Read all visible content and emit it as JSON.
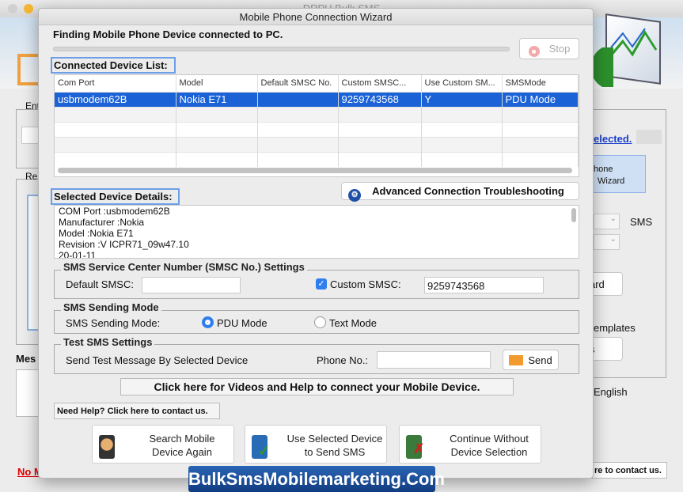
{
  "background_app": {
    "title": "DRPU Bulk SMS",
    "fragments": {
      "enter": "Ent",
      "recipients": "Re",
      "message": "Mes",
      "no": "No M",
      "selected_link": "elected.",
      "wizard_btn_line1": "hone",
      "wizard_btn_line2": "Wizard",
      "sms": "SMS",
      "wizard2": "ard",
      "templates": "emplates",
      "s": "s",
      "english": "English",
      "contact": "re to contact us."
    }
  },
  "dialog": {
    "title": "Mobile Phone Connection Wizard",
    "status": "Finding Mobile Phone Device connected to PC.",
    "progress": 0,
    "stop_label": "Stop",
    "device_list_label": "Connected Device List:",
    "columns": [
      "Com Port",
      "Model",
      "Default SMSC No.",
      "Custom SMSC...",
      "Use Custom SM...",
      "SMSMode"
    ],
    "rows": [
      [
        "usbmodem62B",
        "Nokia E71",
        "",
        "9259743568",
        "Y",
        "PDU Mode"
      ]
    ],
    "details_label": "Selected Device Details:",
    "advanced_label": "Advanced Connection Troubleshooting",
    "details": [
      "COM Port :usbmodem62B",
      "Manufacturer :Nokia",
      "Model :Nokia E71",
      "Revision :V ICPR71_09w47.10",
      "20-01-11"
    ],
    "smsc": {
      "legend": "SMS Service Center Number (SMSC No.) Settings",
      "default_label": "Default SMSC:",
      "default_value": "",
      "custom_label": "Custom SMSC:",
      "custom_checked": true,
      "custom_value": "9259743568"
    },
    "mode": {
      "legend": "SMS Sending Mode",
      "label": "SMS Sending Mode:",
      "pdu": "PDU Mode",
      "text": "Text Mode",
      "selected": "PDU Mode"
    },
    "test": {
      "legend": "Test SMS Settings",
      "label": "Send Test Message By Selected Device",
      "phone_label": "Phone No.:",
      "phone_value": "",
      "send": "Send"
    },
    "help_videos": "Click here for Videos and Help to connect your Mobile Device.",
    "need_help": "Need Help? Click here to contact us.",
    "buttons": {
      "search": [
        "Search Mobile",
        "Device Again"
      ],
      "use": [
        "Use Selected Device",
        "to Send SMS"
      ],
      "continue": [
        "Continue Without",
        "Device Selection"
      ]
    }
  },
  "banner": "BulkSmsMobilemarketing.Com",
  "colors": {
    "selection": "#1a62d6",
    "focus": "#6d9ee8",
    "banner": "#1d4f9c",
    "link": "#1a3fcc",
    "warning": "#e00000"
  }
}
